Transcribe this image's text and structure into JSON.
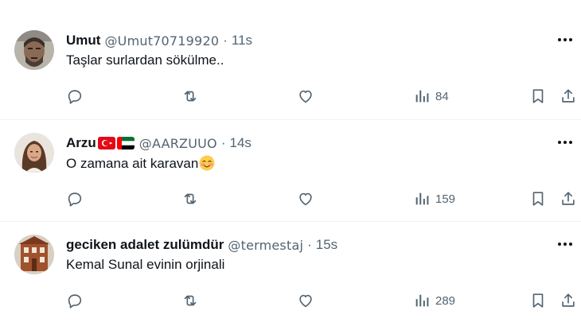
{
  "tweets": [
    {
      "name": "Umut",
      "handle": "@Umut70719920",
      "time": "11s",
      "text": "Taşlar surlardan sökülme..",
      "views": "84",
      "avatar_icon": "avatar-bearded-man"
    },
    {
      "name": "Arzu",
      "flags": [
        "turkey-flag",
        "uae-flag"
      ],
      "handle": "@AARZUUO",
      "time": "14s",
      "text": "O zamana ait karavan",
      "text_emoji": "smiling-face-with-blush-emoji",
      "views": "159",
      "avatar_icon": "avatar-woman"
    },
    {
      "name": "geciken adalet zulümdür",
      "handle": "@termestaj",
      "time": "15s",
      "text": "Kemal Sunal evinin orjinali",
      "views": "289",
      "avatar_icon": "avatar-building"
    }
  ],
  "separator": "·",
  "colors": {
    "text": "#0f1419",
    "secondary": "#536471",
    "divider": "#eff3f4"
  }
}
